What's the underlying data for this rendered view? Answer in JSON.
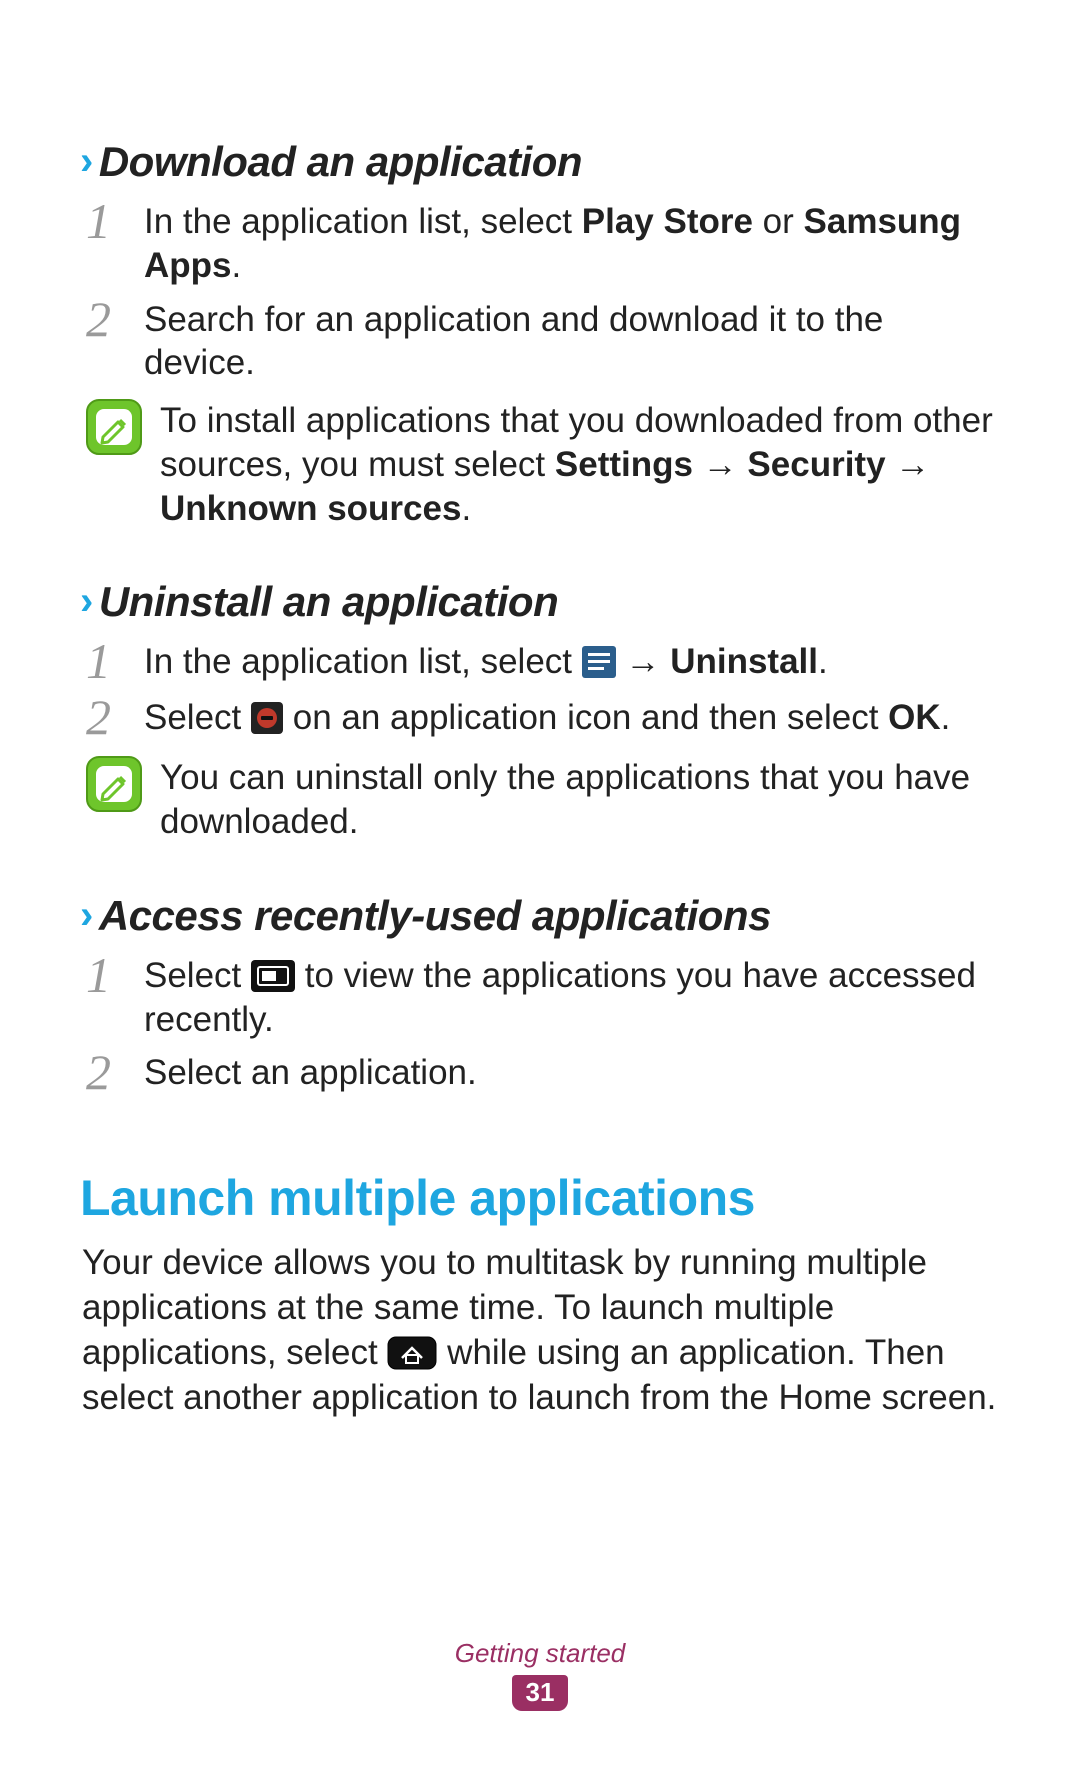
{
  "sections": {
    "download": {
      "heading": "Download an application",
      "step1_pre": "In the application list, select ",
      "step1_b1": "Play Store",
      "step1_mid": " or ",
      "step1_b2": "Samsung Apps",
      "step1_post": ".",
      "step2": "Search for an application and download it to the device.",
      "note_pre": "To install applications that you downloaded from other sources, you must select ",
      "note_b1": "Settings",
      "note_arrow1": " → ",
      "note_b2": "Security",
      "note_arrow2": " → ",
      "note_b3": "Unknown sources",
      "note_post": "."
    },
    "uninstall": {
      "heading": "Uninstall an application",
      "step1_pre": "In the application list, select ",
      "step1_arrow": " → ",
      "step1_b": "Uninstall",
      "step1_post": ".",
      "step2_pre": "Select ",
      "step2_mid": " on an application icon and then select ",
      "step2_b": "OK",
      "step2_post": ".",
      "note": "You can uninstall only the applications that you have downloaded."
    },
    "recent": {
      "heading": "Access recently-used applications",
      "step1_pre": "Select ",
      "step1_post": " to view the applications you have accessed recently.",
      "step2": "Select an application."
    }
  },
  "launch": {
    "heading": "Launch multiple applications",
    "body_pre": "Your device allows you to multitask by running multiple applications at the same time. To launch multiple applications, select ",
    "body_post": " while using an application. Then select another application to launch from the Home screen."
  },
  "footer": {
    "section_label": "Getting started",
    "page_number": "31"
  },
  "nums": {
    "one": "1",
    "two": "2"
  }
}
